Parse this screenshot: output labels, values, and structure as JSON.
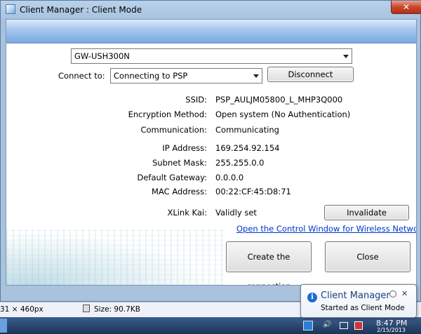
{
  "window": {
    "title": "Client Manager : Client Mode",
    "close_glyph": "✕"
  },
  "adapter": {
    "selected": "GW-USH300N"
  },
  "connect": {
    "label": "Connect to:",
    "selected": "Connecting to PSP",
    "disconnect_label": "Disconnect"
  },
  "info": {
    "ssid_label": "SSID:",
    "ssid": "PSP_AULJM05800_L_MHP3Q000",
    "encryption_label": "Encryption Method:",
    "encryption": "Open system (No Authentication)",
    "communication_label": "Communication:",
    "communication": "Communicating",
    "ip_label": "IP Address:",
    "ip": "169.254.92.154",
    "subnet_label": "Subnet Mask:",
    "subnet": "255.255.0.0",
    "gateway_label": "Default Gateway:",
    "gateway": "0.0.0.0",
    "mac_label": "MAC Address:",
    "mac": "00:22:CF:45:D8:71",
    "xlink_label": "XLink Kai:",
    "xlink": "Validly set",
    "invalidate_label": "Invalidate"
  },
  "link": {
    "control_window": "Open the Control Window for Wireless Network"
  },
  "buttons": {
    "create_label": "Create the connection",
    "close_label": "Close"
  },
  "statusbar": {
    "dimensions": "31 × 460px",
    "size": "Size: 90.7KB"
  },
  "balloon": {
    "title": "Client Manager",
    "message": "Started as Client Mode",
    "close_glyph": "✕"
  },
  "taskbar": {
    "time": "8:47 PM",
    "date": "2/15/2013"
  },
  "icons": {
    "info": "i",
    "speaker": "🔊"
  }
}
